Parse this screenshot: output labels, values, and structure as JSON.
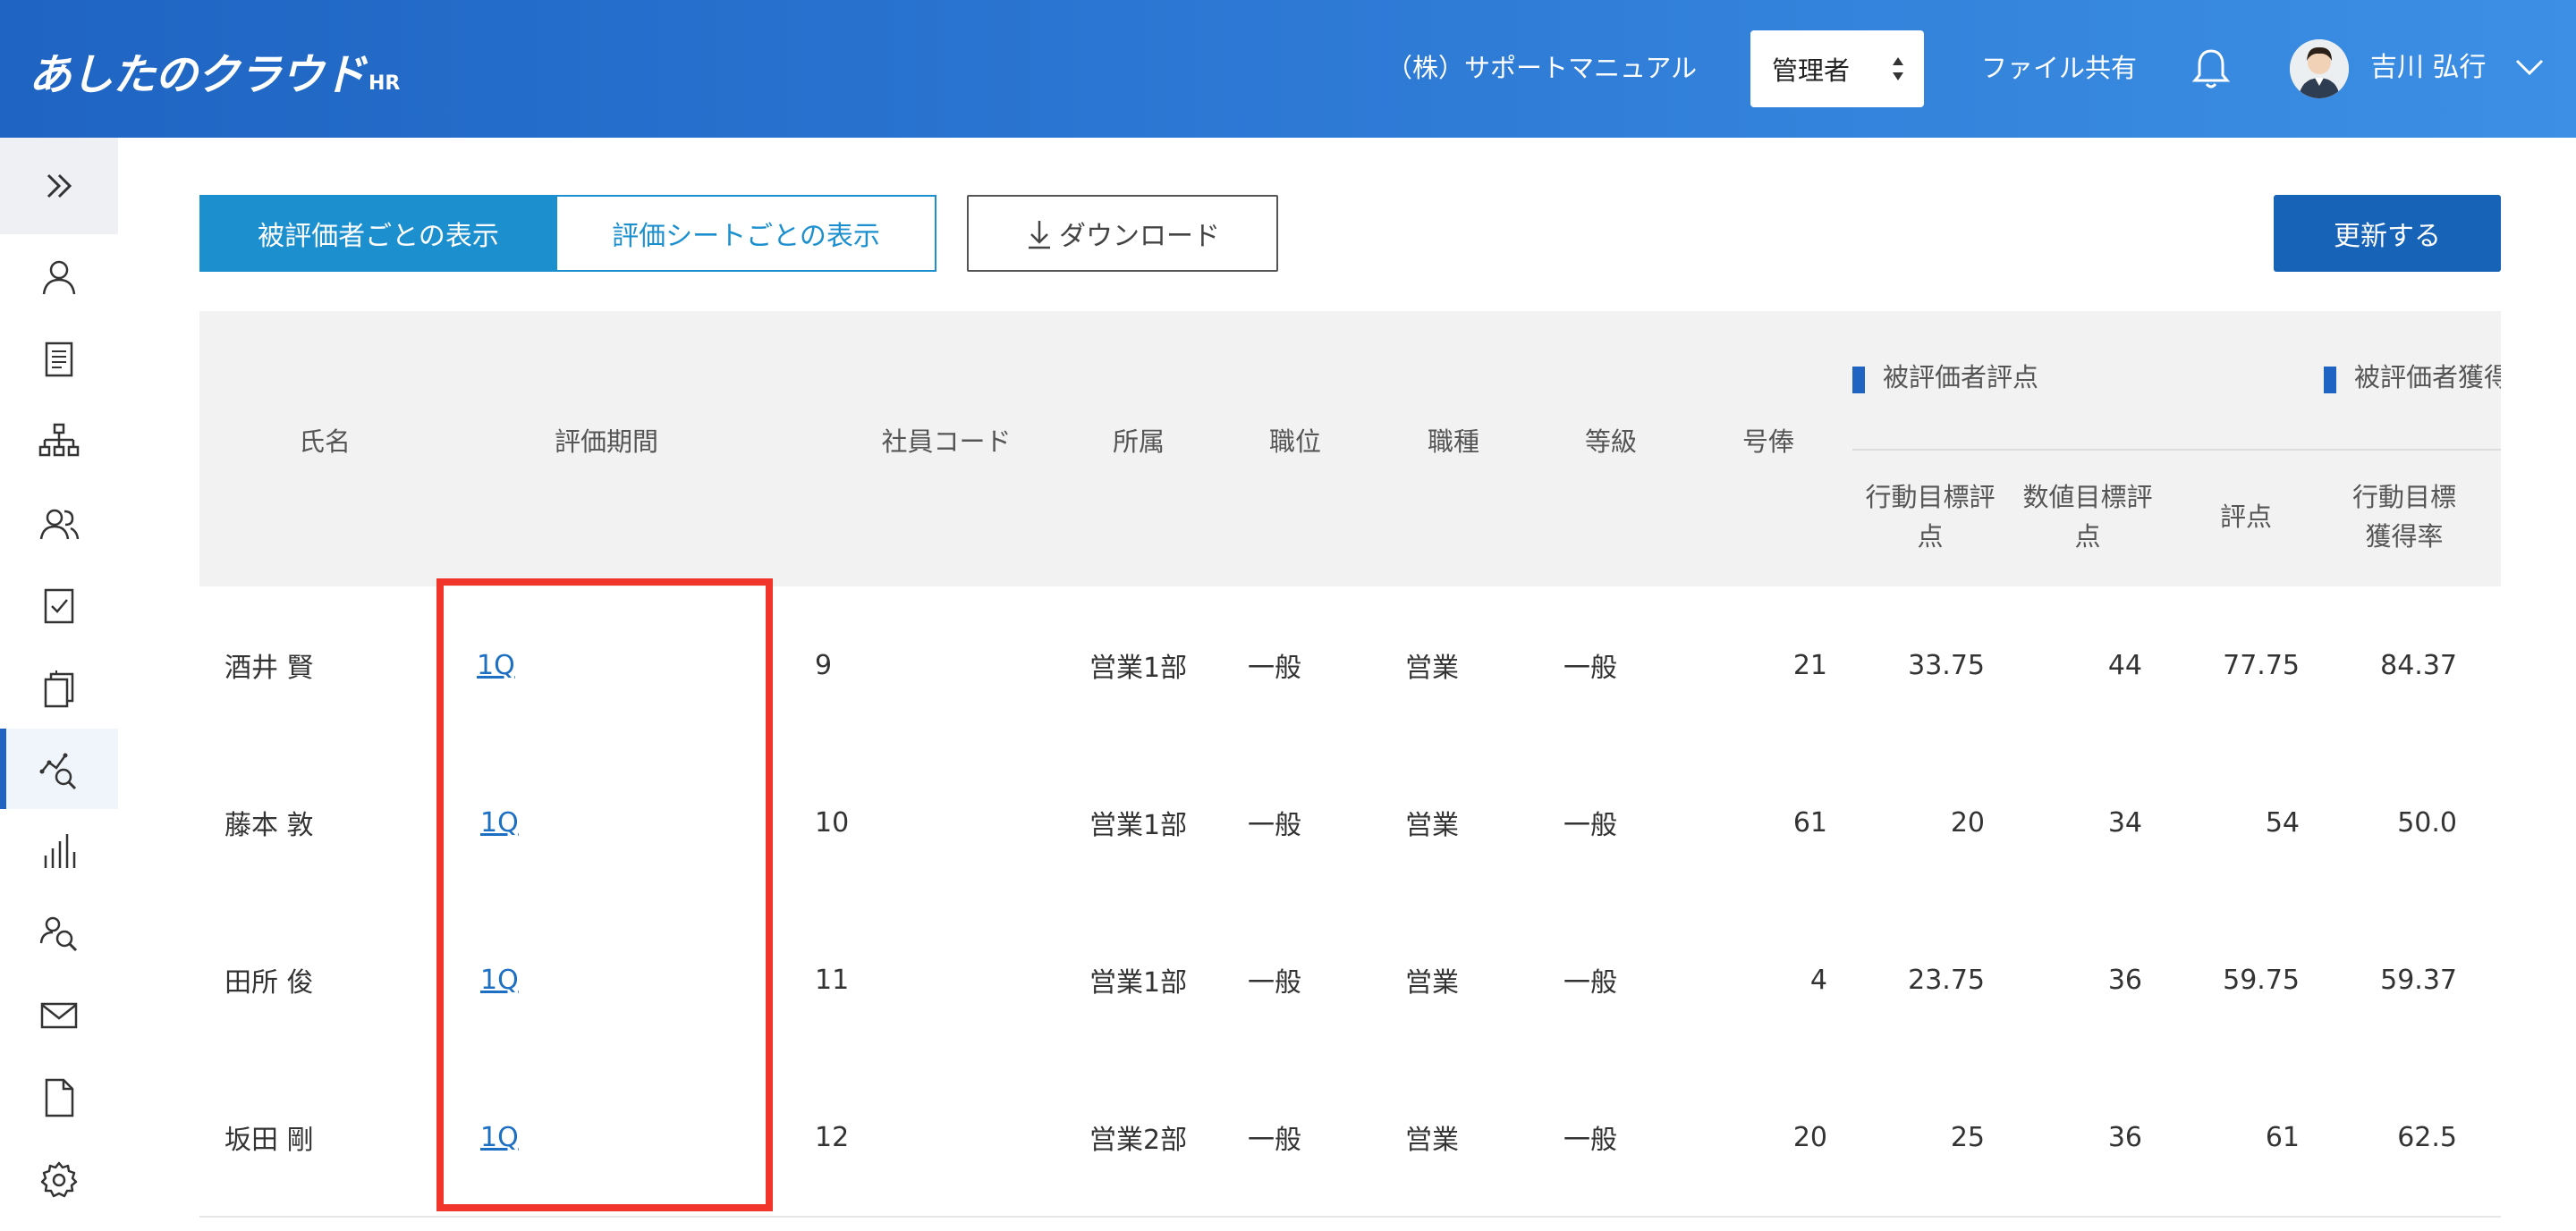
{
  "header": {
    "logo_main": "あしたのクラウド",
    "logo_sub": "HR",
    "company": "（株）サポートマニュアル",
    "role": "管理者",
    "file_share": "ファイル共有",
    "user_name": "吉川 弘行"
  },
  "sidebar": {
    "items": [
      {
        "icon": "person-icon"
      },
      {
        "icon": "document-icon"
      },
      {
        "icon": "org-chart-icon"
      },
      {
        "icon": "users-icon"
      },
      {
        "icon": "checklist-icon"
      },
      {
        "icon": "copy-icon"
      },
      {
        "icon": "analysis-search-icon",
        "active": true
      },
      {
        "icon": "bar-chart-icon"
      },
      {
        "icon": "user-search-icon"
      },
      {
        "icon": "mail-icon"
      },
      {
        "icon": "file-icon"
      },
      {
        "icon": "gear-icon"
      }
    ]
  },
  "toolbar": {
    "tab_by_evaluatee": "被評価者ごとの表示",
    "tab_by_sheet": "評価シートごとの表示",
    "download": "ダウンロード",
    "update": "更新する"
  },
  "table": {
    "headers": {
      "name": "氏名",
      "period": "評価期間",
      "employee_code": "社員コード",
      "department": "所属",
      "position": "職位",
      "job_type": "職種",
      "grade": "等級",
      "salary_step": "号俸",
      "group_score": "被評価者評点",
      "group_rate": "被評価者獲得",
      "behavior_score_l1": "行動目標評",
      "behavior_score_l2": "点",
      "numeric_score_l1": "数値目標評",
      "numeric_score_l2": "点",
      "score": "評点",
      "behavior_rate_l1": "行動目標",
      "behavior_rate_l2": "獲得率"
    },
    "rows": [
      {
        "name": "酒井 賢",
        "period": "1Q",
        "code": "9",
        "dept": "営業1部",
        "position": "一般",
        "job": "営業",
        "grade": "一般",
        "step": "21",
        "behavior": "33.75",
        "numeric": "44",
        "score": "77.75",
        "rate": "84.37"
      },
      {
        "name": "藤本 敦",
        "period": "1Q",
        "code": "10",
        "dept": "営業1部",
        "position": "一般",
        "job": "営業",
        "grade": "一般",
        "step": "61",
        "behavior": "20",
        "numeric": "34",
        "score": "54",
        "rate": "50.0"
      },
      {
        "name": "田所 俊",
        "period": "1Q",
        "code": "11",
        "dept": "営業1部",
        "position": "一般",
        "job": "営業",
        "grade": "一般",
        "step": "4",
        "behavior": "23.75",
        "numeric": "36",
        "score": "59.75",
        "rate": "59.37"
      },
      {
        "name": "坂田 剛",
        "period": "1Q",
        "code": "12",
        "dept": "営業2部",
        "position": "一般",
        "job": "営業",
        "grade": "一般",
        "step": "20",
        "behavior": "25",
        "numeric": "36",
        "score": "61",
        "rate": "62.5"
      }
    ]
  }
}
